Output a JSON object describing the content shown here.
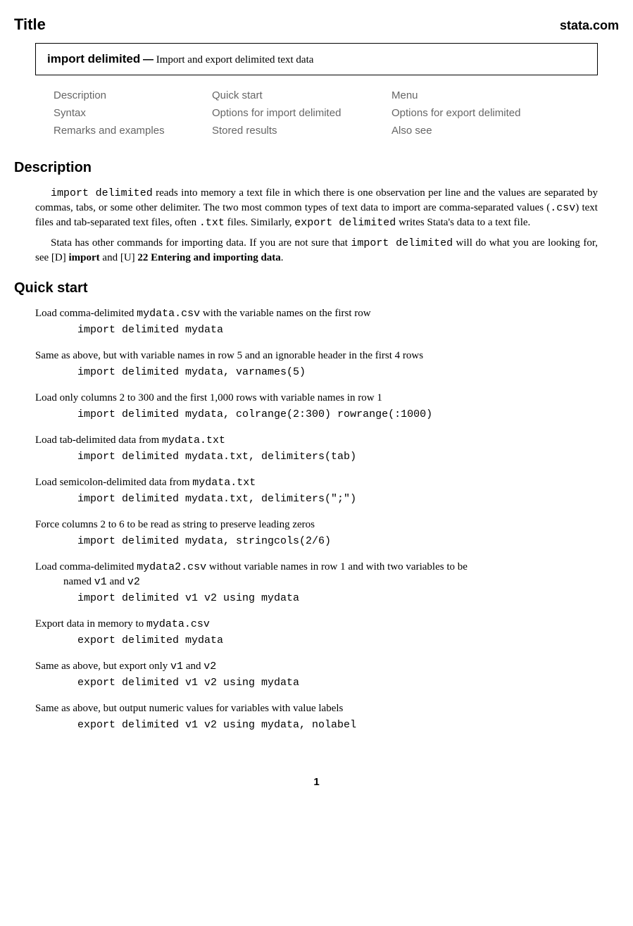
{
  "header": {
    "title": "Title",
    "brand": "stata.com"
  },
  "title_box": {
    "command": "import delimited",
    "separator": "—",
    "subtitle": "Import and export delimited text data"
  },
  "toc": {
    "rows": [
      {
        "c1": "Description",
        "c2": "Quick start",
        "c3": "Menu"
      },
      {
        "c1": "Syntax",
        "c2": "Options for import delimited",
        "c3": "Options for export delimited"
      },
      {
        "c1": "Remarks and examples",
        "c2": "Stored results",
        "c3": "Also see"
      }
    ]
  },
  "description_heading": "Description",
  "description": {
    "p1a": "import delimited",
    "p1b": " reads into memory a text file in which there is one observation per line and the values are separated by commas, tabs, or some other delimiter. The two most common types of text data to import are comma-separated values (",
    "p1c": ".csv",
    "p1d": ") text files and tab-separated text files, often ",
    "p1e": ".txt",
    "p1f": " files. Similarly, ",
    "p1g": "export delimited",
    "p1h": " writes Stata's data to a text file.",
    "p2a": "Stata has other commands for importing data. If you are not sure that ",
    "p2b": "import delimited",
    "p2c": " will do what you are looking for, see [",
    "p2d": "D",
    "p2e": "] ",
    "p2f": "import",
    "p2g": " and [",
    "p2h": "U",
    "p2i": "] ",
    "p2j": "22 Entering and importing data",
    "p2k": "."
  },
  "quickstart_heading": "Quick start",
  "qs": [
    {
      "desc_pre": "Load comma-delimited ",
      "desc_tt": "mydata.csv",
      "desc_post": " with the variable names on the first row",
      "code": "import delimited mydata"
    },
    {
      "desc_pre": "Same as above, but with variable names in row 5 and an ignorable header in the first 4 rows",
      "desc_tt": "",
      "desc_post": "",
      "code": "import delimited mydata, varnames(5)"
    },
    {
      "desc_pre": "Load only columns 2 to 300 and the first 1,000 rows with variable names in row 1",
      "desc_tt": "",
      "desc_post": "",
      "code": "import delimited mydata, colrange(2:300) rowrange(:1000)"
    },
    {
      "desc_pre": "Load tab-delimited data from ",
      "desc_tt": "mydata.txt",
      "desc_post": "",
      "code": "import delimited mydata.txt, delimiters(tab)"
    },
    {
      "desc_pre": "Load semicolon-delimited data from ",
      "desc_tt": "mydata.txt",
      "desc_post": "",
      "code": "import delimited mydata.txt, delimiters(\";\")"
    },
    {
      "desc_pre": "Force columns 2 to 6 to be read as string to preserve leading zeros",
      "desc_tt": "",
      "desc_post": "",
      "code": "import delimited mydata, stringcols(2/6)"
    },
    {
      "desc_pre": "Load comma-delimited ",
      "desc_tt": "mydata2.csv",
      "desc_post": " without variable names in row 1 and with two variables to be",
      "cont_pre": "named ",
      "cont_tt1": "v1",
      "cont_mid": " and ",
      "cont_tt2": "v2",
      "code": "import delimited v1 v2 using mydata"
    },
    {
      "desc_pre": "Export data in memory to ",
      "desc_tt": "mydata.csv",
      "desc_post": "",
      "code": "export delimited mydata"
    },
    {
      "desc_pre": "Same as above, but export only ",
      "desc_tt": "v1",
      "desc_mid": " and ",
      "desc_tt2": "v2",
      "desc_post": "",
      "code": "export delimited v1 v2 using mydata"
    },
    {
      "desc_pre": "Same as above, but output numeric values for variables with value labels",
      "desc_tt": "",
      "desc_post": "",
      "code": "export delimited v1 v2 using mydata, nolabel"
    }
  ],
  "page_number": "1"
}
